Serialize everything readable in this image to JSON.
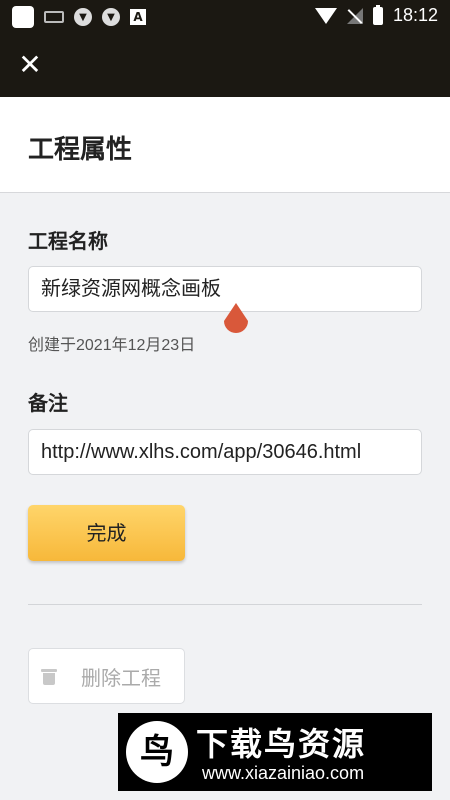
{
  "status_bar": {
    "time": "18:12",
    "notif_letter": "A"
  },
  "toolbar": {
    "close_glyph": "✕"
  },
  "page": {
    "title": "工程属性"
  },
  "project_name": {
    "label": "工程名称",
    "value": "新绿资源网概念画板",
    "created": "创建于2021年12月23日"
  },
  "notes": {
    "label": "备注",
    "value": "http://www.xlhs.com/app/30646.html"
  },
  "actions": {
    "done_label": "完成",
    "delete_label": "删除工程"
  },
  "watermark": {
    "logo_char": "鸟",
    "title": "下载鸟资源",
    "url": "www.xiazainiao.com"
  },
  "colors": {
    "header_bg": "#1b1812",
    "accent": "#f7b83a",
    "cursor_handle": "#d9583a"
  },
  "icons": [
    "close-icon",
    "trash-icon",
    "wifi-icon",
    "battery-icon",
    "text-cursor-handle-icon"
  ]
}
